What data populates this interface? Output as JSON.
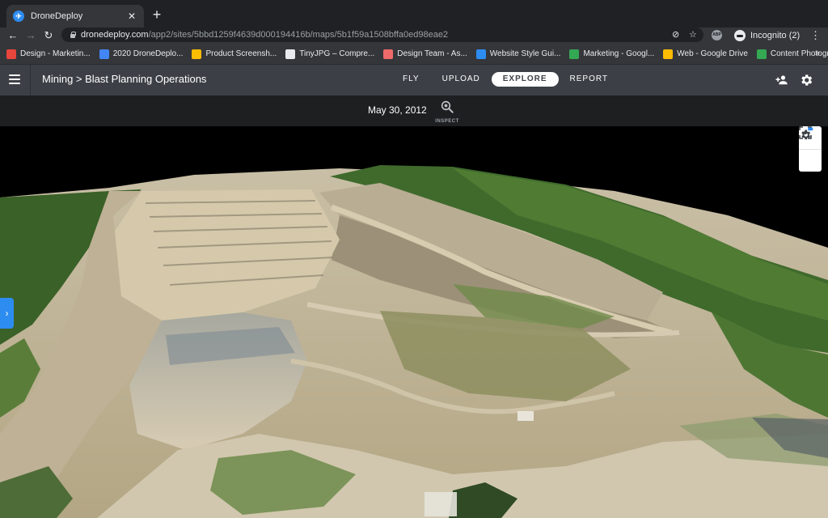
{
  "browser": {
    "tab_title": "DroneDeploy",
    "url_host": "dronedeploy.com",
    "url_path": "/app2/sites/5bbd1259f4639d000194416b/maps/5b1f59a1508bffa0ed98eae2",
    "incognito_label": "Incognito (2)",
    "ext_label": "ABP",
    "bookmarks": [
      {
        "label": "Design - Marketin...",
        "color": "#e8453c"
      },
      {
        "label": "2020 DroneDeplo...",
        "color": "#4285f4"
      },
      {
        "label": "Product Screensh...",
        "color": "#fbbc04"
      },
      {
        "label": "TinyJPG – Compre...",
        "color": "#e8eaed"
      },
      {
        "label": "Design Team - As...",
        "color": "#f06a6a"
      },
      {
        "label": "Website Style Gui...",
        "color": "#2d8cf0"
      },
      {
        "label": "Marketing - Googl...",
        "color": "#34a853"
      },
      {
        "label": "Web - Google Drive",
        "color": "#fbbc04"
      },
      {
        "label": "Content Photogra...",
        "color": "#34a853"
      }
    ],
    "bookmarks_more": "»"
  },
  "header": {
    "breadcrumb": "Mining > Blast Planning Operations",
    "tabs": [
      {
        "label": "FLY",
        "active": false
      },
      {
        "label": "UPLOAD",
        "active": false
      },
      {
        "label": "EXPLORE",
        "active": true
      },
      {
        "label": "REPORT",
        "active": false
      }
    ]
  },
  "datebar": {
    "date": "May 30, 2012",
    "inspect_label": "INSPECT"
  },
  "icons": {
    "favicon": "drone-logo-icon",
    "tab_close": "close-icon",
    "new_tab": "plus-icon",
    "back": "arrow-left-icon",
    "forward": "arrow-right-icon",
    "reload": "reload-icon",
    "lock": "lock-icon",
    "location": "location-blocked-icon",
    "star": "star-icon",
    "menu": "hamburger-icon",
    "add_user": "add-user-icon",
    "settings": "gear-icon",
    "inspect": "magnifier-icon",
    "focus": "focus-frame-icon",
    "viewer_settings": "gear-badge-icon",
    "side_panel": "chevron-right-icon"
  },
  "colors": {
    "accent": "#2d8cf0",
    "header_bg": "#3c4046",
    "date_bar_bg": "#1e1f21"
  }
}
